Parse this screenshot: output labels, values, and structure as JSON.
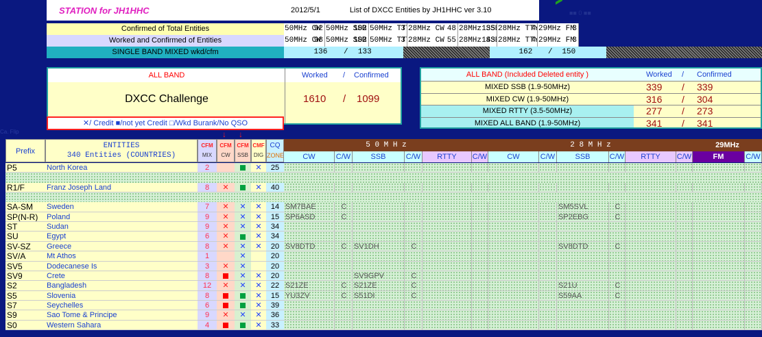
{
  "header": {
    "station": "STATION for JH1HHC",
    "date": "2012/5/1",
    "list_title": "List of DXCC Entities by JH1HHC ver 3.10",
    "faint_note": "■■ 0 ■■"
  },
  "stats": {
    "confirmed_label": "Confirmed of Total Entities",
    "worked_label": "Worked and Confirmed of Entities",
    "single_label": "SINGLE BAND MIXED  wkd/cfm",
    "columns": [
      {
        "mode": "50MHz CW",
        "confirmed": "92",
        "worked": "98"
      },
      {
        "mode": "50MHz SSB",
        "confirmed": "102",
        "worked": "102"
      },
      {
        "mode": "50MHz TTY",
        "confirmed": "3",
        "worked": "3"
      },
      {
        "mode": "28MHz CW",
        "confirmed": "48",
        "worked": "55"
      },
      {
        "mode": "28MHz SSB",
        "confirmed": "135",
        "worked": "143"
      },
      {
        "mode": "28MHz TTY",
        "confirmed": "4",
        "worked": "4"
      },
      {
        "mode": "29MHz FM",
        "confirmed": "3",
        "worked": "3"
      }
    ],
    "single_50": {
      "wkd": "136",
      "sep": "/",
      "cfm": "133"
    },
    "single_28": {
      "wkd": "162",
      "sep": "/",
      "cfm": "150"
    }
  },
  "allband": {
    "label": "ALL BAND",
    "worked_hdr": "Worked",
    "sep": "/",
    "confirmed_hdr": "Confirmed",
    "challenge_label": "DXCC Challenge",
    "worked": "1610",
    "confirmed": "1099"
  },
  "legend": "✕/ Credit  ■/not yet Credit  □/Wkd  Burank/No QSO",
  "deleted": {
    "label": "ALL BAND (Included Deleted entity )",
    "worked_hdr": "Worked",
    "sep": "/",
    "confirmed_hdr": "Confirmed",
    "rows": [
      {
        "label": "MIXED  SSB (1.9-50MHz)",
        "worked": "339",
        "confirmed": "339"
      },
      {
        "label": "MIXED  CW (1.9-50MHz)",
        "worked": "316",
        "confirmed": "304"
      },
      {
        "label": "MIXED  RTTY (3.5-50MHz)",
        "worked": "277",
        "confirmed": "273"
      },
      {
        "label": "MIXED ALL BAND (1.9-50MHz)",
        "worked": "341",
        "confirmed": "341"
      }
    ]
  },
  "table": {
    "prefix_hdr": "Prefix",
    "entities_hdr": "ENTITIES",
    "entities_sub": "340 Entities  (COUNTRIES)",
    "cfm_hdrs": [
      {
        "top": "CFM",
        "sub": "MIX"
      },
      {
        "top": "CFM",
        "sub": "CW"
      },
      {
        "top": "CFM",
        "sub": "SSB"
      },
      {
        "top": "CMF",
        "sub": "DIG"
      }
    ],
    "cq_hdr": "CQ",
    "zone_hdr": "ZONE",
    "band50": "5 0 M H z",
    "band28": "2 8 M H z",
    "band29": "29MHz",
    "sub_cols": [
      "CW",
      "C/W",
      "SSB",
      "C/W",
      "RTTY",
      "C/W",
      "CW",
      "C/W",
      "SSB",
      "C/W",
      "RTTY",
      "C/W",
      "FM",
      "C/W"
    ],
    "arrow": "↓",
    "rows": [
      {
        "prefix": "P5",
        "entity": "North Korea",
        "mix": "2",
        "cw": "",
        "ssb": "G",
        "dig": "x",
        "zone": "25",
        "cw50": "",
        "cw50c": "",
        "ssb50": "",
        "ssb50c": "",
        "cw28": "",
        "cw28c": "",
        "ssb28": "",
        "ssb28c": ""
      },
      {
        "blank": true
      },
      {
        "prefix": "R1/F",
        "entity": "Franz Joseph Land",
        "mix": "8",
        "cw": "xr",
        "ssb": "G",
        "dig": "x",
        "zone": "40",
        "cw50": "",
        "cw50c": "",
        "ssb50": "",
        "ssb50c": "",
        "cw28": "",
        "cw28c": "",
        "ssb28": "",
        "ssb28c": ""
      },
      {
        "blank": true
      },
      {
        "prefix": "SA-SM",
        "entity": "Sweden",
        "mix": "7",
        "cw": "xr",
        "ssb": "x",
        "dig": "x",
        "zone": "14",
        "cw50": "SM7BAE",
        "cw50c": "C",
        "ssb50": "",
        "ssb50c": "",
        "cw28": "",
        "cw28c": "",
        "ssb28": "SM5SVL",
        "ssb28c": "C"
      },
      {
        "prefix": "SP(N-R)",
        "entity": "Poland",
        "mix": "9",
        "cw": "xr",
        "ssb": "x",
        "dig": "x",
        "zone": "15",
        "cw50": "SP6ASD",
        "cw50c": "C",
        "ssb50": "",
        "ssb50c": "",
        "cw28": "",
        "cw28c": "",
        "ssb28": "SP2EBG",
        "ssb28c": "C"
      },
      {
        "prefix": "ST",
        "entity": "Sudan",
        "mix": "9",
        "cw": "xr",
        "ssb": "x",
        "dig": "x",
        "zone": "34",
        "cw50": "",
        "cw50c": "",
        "ssb50": "",
        "ssb50c": "",
        "cw28": "",
        "cw28c": "",
        "ssb28": "",
        "ssb28c": ""
      },
      {
        "prefix": "SU",
        "entity": "Egypt",
        "mix": "6",
        "cw": "xr",
        "ssb": "G",
        "dig": "x",
        "zone": "34",
        "cw50": "",
        "cw50c": "",
        "ssb50": "",
        "ssb50c": "",
        "cw28": "",
        "cw28c": "",
        "ssb28": "",
        "ssb28c": ""
      },
      {
        "prefix": "SV-SZ",
        "entity": "Greece",
        "mix": "8",
        "cw": "xr",
        "ssb": "x",
        "dig": "x",
        "zone": "20",
        "cw50": "SV8DTD",
        "cw50c": "C",
        "ssb50": "SV1DH",
        "ssb50c": "C",
        "cw28": "",
        "cw28c": "",
        "ssb28": "SV8DTD",
        "ssb28c": "C"
      },
      {
        "prefix": "SV/A",
        "entity": "Mt Athos",
        "mix": "1",
        "cw": "",
        "ssb": "x",
        "dig": "",
        "zone": "20",
        "cw50": "",
        "cw50c": "",
        "ssb50": "",
        "ssb50c": "",
        "cw28": "",
        "cw28c": "",
        "ssb28": "",
        "ssb28c": ""
      },
      {
        "prefix": "SV5",
        "entity": "Dodecanese Is",
        "mix": "3",
        "cw": "xr",
        "ssb": "x",
        "dig": "",
        "zone": "20",
        "cw50": "",
        "cw50c": "",
        "ssb50": "",
        "ssb50c": "",
        "cw28": "",
        "cw28c": "",
        "ssb28": "",
        "ssb28c": ""
      },
      {
        "prefix": "SV9",
        "entity": "Crete",
        "mix": "8",
        "cw": "R",
        "ssb": "x",
        "dig": "x",
        "zone": "20",
        "cw50": "",
        "cw50c": "",
        "ssb50": "SV9GPV",
        "ssb50c": "C",
        "cw28": "",
        "cw28c": "",
        "ssb28": "",
        "ssb28c": ""
      },
      {
        "prefix": "S2",
        "entity": "Bangladesh",
        "mix": "12",
        "cw": "xr",
        "ssb": "x",
        "dig": "x",
        "zone": "22",
        "cw50": "S21ZE",
        "cw50c": "C",
        "ssb50": "S21ZE",
        "ssb50c": "C",
        "cw28": "",
        "cw28c": "",
        "ssb28": "S21U",
        "ssb28c": "C"
      },
      {
        "prefix": "S5",
        "entity": "Slovenia",
        "mix": "8",
        "cw": "R",
        "ssb": "G",
        "dig": "x",
        "zone": "15",
        "cw50": "YU3ZV",
        "cw50c": "C",
        "ssb50": "S51DI",
        "ssb50c": "C",
        "cw28": "",
        "cw28c": "",
        "ssb28": "S59AA",
        "ssb28c": "C"
      },
      {
        "prefix": "S7",
        "entity": "Seychelles",
        "mix": "6",
        "cw": "R",
        "ssb": "G",
        "dig": "x",
        "zone": "39",
        "cw50": "",
        "cw50c": "",
        "ssb50": "",
        "ssb50c": "",
        "cw28": "",
        "cw28c": "",
        "ssb28": "",
        "ssb28c": ""
      },
      {
        "prefix": "S9",
        "entity": "Sao Tome & Principe",
        "mix": "9",
        "cw": "xr",
        "ssb": "x",
        "dig": "x",
        "zone": "36",
        "cw50": "",
        "cw50c": "",
        "ssb50": "",
        "ssb50c": "",
        "cw28": "",
        "cw28c": "",
        "ssb28": "",
        "ssb28c": ""
      },
      {
        "prefix": "S0",
        "entity": "Western Sahara",
        "mix": "4",
        "cw": "R",
        "ssb": "G",
        "dig": "x",
        "zone": "33",
        "cw50": "",
        "cw50c": "",
        "ssb50": "",
        "ssb50c": "",
        "cw28": "",
        "cw28c": "",
        "ssb28": "",
        "ssb28c": ""
      }
    ]
  }
}
